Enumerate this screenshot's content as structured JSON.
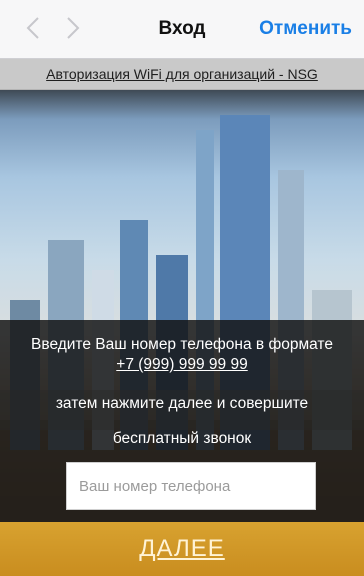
{
  "navbar": {
    "back_icon": "chevron-left-icon",
    "forward_icon": "chevron-right-icon",
    "title": "Вход",
    "cancel_label": "Отменить",
    "accent_color": "#1a7fe6"
  },
  "banner": {
    "link_text": "Авторизация WiFi для организаций - NSG"
  },
  "hero": {
    "image": "city-skyline-photo"
  },
  "form": {
    "instruction_line1": "Введите Ваш номер телефона в формате",
    "phone_example": "+7 (999) 999 99 99",
    "instruction_line2": "затем нажмите далее и совершите",
    "instruction_line3": "бесплатный звонок",
    "phone_placeholder": "Ваш номер телефона",
    "phone_value": "",
    "next_label": "ДАЛЕЕ",
    "next_color": "#d39a2a"
  }
}
